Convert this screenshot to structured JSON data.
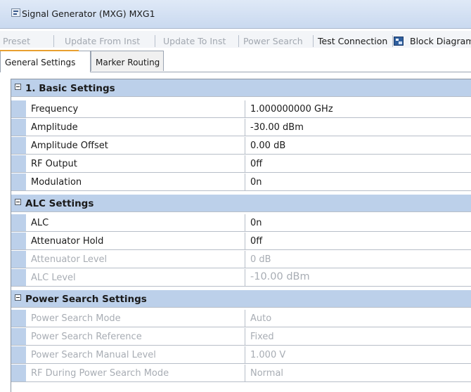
{
  "window": {
    "title": "Signal Generator (MXG) MXG1"
  },
  "toolbar": {
    "preset": "Preset",
    "update_from_inst": "Update From Inst",
    "update_to_inst": "Update To Inst",
    "power_search": "Power Search",
    "test_connection": "Test Connection",
    "block_diagram": "Block Diagram"
  },
  "tabs": [
    "General Settings",
    "Marker Routing"
  ],
  "sections": [
    {
      "title": "1. Basic Settings",
      "rows": [
        {
          "name": "Frequency",
          "value": "1.000000000 GHz"
        },
        {
          "name": "Amplitude",
          "value": "-30.00 dBm"
        },
        {
          "name": "Amplitude Offset",
          "value": "0.00 dB"
        },
        {
          "name": "RF Output",
          "value": "0ff"
        },
        {
          "name": "Modulation",
          "value": "0n"
        }
      ]
    },
    {
      "title": "ALC Settings",
      "rows": [
        {
          "name": "ALC",
          "value": "0n"
        },
        {
          "name": "Attenuator Hold",
          "value": "0ff"
        },
        {
          "name": "Attenuator Level",
          "value": "0 dB"
        },
        {
          "name": "ALC Level",
          "value": "-10.00 dBm"
        }
      ]
    },
    {
      "title": "Power Search Settings",
      "rows": [
        {
          "name": "Power Search Mode",
          "value": "Auto"
        },
        {
          "name": "Power Search Reference",
          "value": "Fixed"
        },
        {
          "name": "Power Search Manual Level",
          "value": "1.000 V"
        },
        {
          "name": "RF During Power Search Mode",
          "value": "Normal"
        }
      ]
    }
  ]
}
